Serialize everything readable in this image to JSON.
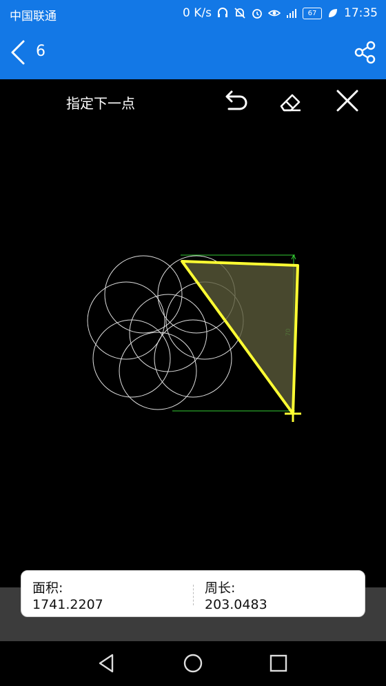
{
  "status_bar": {
    "carrier": "中国联通",
    "net_speed": "0 K/s",
    "battery": "67",
    "time": "17:35"
  },
  "title_bar": {
    "title": "6"
  },
  "toolbar": {
    "hint": "指定下一点"
  },
  "drawing": {
    "dimension_label": "70",
    "polygon_color": "#ffff33",
    "fill_color": "#5a5a3a",
    "circle_color": "#e0e0e0",
    "dimension_color": "#33cc33"
  },
  "result": {
    "area_label": "面积:",
    "area_value": "1741.2207",
    "perimeter_label": "周长:",
    "perimeter_value": "203.0483"
  },
  "colors": {
    "brand_blue": "#1378e6"
  }
}
